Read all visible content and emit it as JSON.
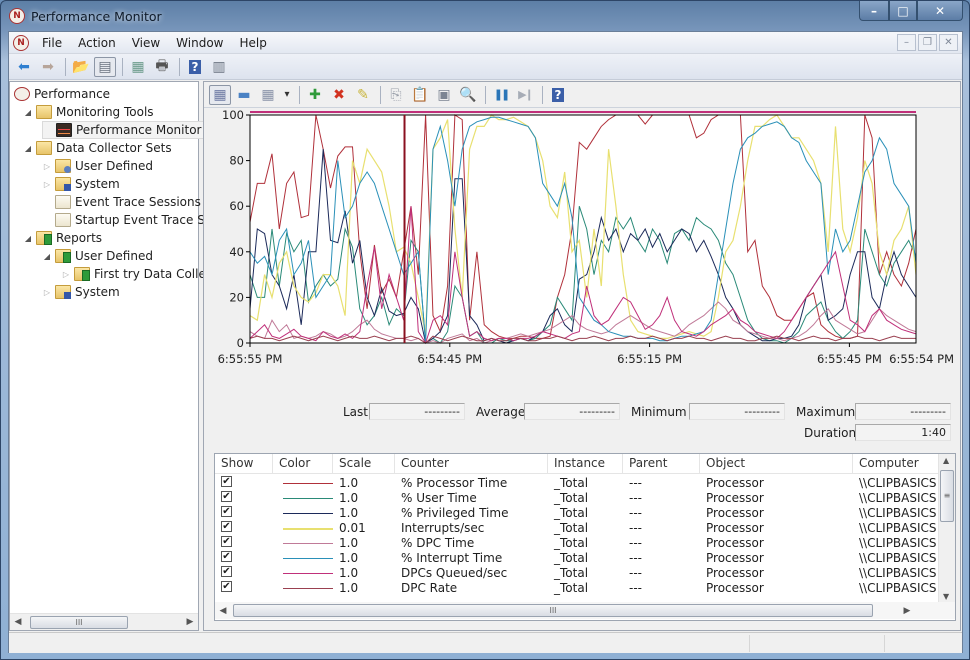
{
  "window": {
    "title": "Performance Monitor",
    "app_icon_glyph": "N",
    "caption_buttons": {
      "minimize": "–",
      "maximize": "□",
      "close": "✕"
    }
  },
  "menubar": {
    "items": [
      "File",
      "Action",
      "View",
      "Window",
      "Help"
    ],
    "mdi_buttons": {
      "minimize": "–",
      "restore": "❐",
      "close": "✕"
    }
  },
  "toolbar": {
    "items": [
      {
        "name": "back-button",
        "glyph": "⬅",
        "color": "#2f7fd0"
      },
      {
        "name": "forward-button",
        "glyph": "➡",
        "color": "#b7a59a"
      },
      {
        "name": "up-folder-button",
        "glyph": "📂",
        "color": "#d6a83a"
      },
      {
        "name": "show-hide-console-tree-button",
        "glyph": "▤",
        "color": "#6a7380"
      },
      {
        "name": "export-list-button",
        "glyph": "▦",
        "color": "#6a9a8a"
      },
      {
        "name": "print-button",
        "glyph": "🖶",
        "color": "#555"
      },
      {
        "name": "help-button",
        "glyph": "?",
        "color": "#3b5fa8"
      },
      {
        "name": "show-hide-action-pane-button",
        "glyph": "▥",
        "color": "#6a7380"
      }
    ]
  },
  "tree": {
    "items": [
      {
        "label": "Performance",
        "level": 0,
        "arrow": "",
        "icon": "root"
      },
      {
        "label": "Monitoring Tools",
        "level": 1,
        "arrow": "◢",
        "icon": "folder"
      },
      {
        "label": "Performance Monitor",
        "level": 2,
        "arrow": "",
        "icon": "perfmon",
        "selected": true
      },
      {
        "label": "Data Collector Sets",
        "level": 1,
        "arrow": "◢",
        "icon": "folder"
      },
      {
        "label": "User Defined",
        "level": 2,
        "arrow": "▷",
        "icon": "user"
      },
      {
        "label": "System",
        "level": 2,
        "arrow": "▷",
        "icon": "sys"
      },
      {
        "label": "Event Trace Sessions",
        "level": 2,
        "arrow": "",
        "icon": "doc"
      },
      {
        "label": "Startup Event Trace Ses",
        "level": 2,
        "arrow": "",
        "icon": "doc"
      },
      {
        "label": "Reports",
        "level": 1,
        "arrow": "◢",
        "icon": "report"
      },
      {
        "label": "User Defined",
        "level": 2,
        "arrow": "◢",
        "icon": "report"
      },
      {
        "label": "First try  Data Collec",
        "level": 3,
        "arrow": "▷",
        "icon": "report"
      },
      {
        "label": "System",
        "level": 2,
        "arrow": "▷",
        "icon": "sys"
      }
    ],
    "scroll_thumb_glyph": "III"
  },
  "perf_toolbar": {
    "items": [
      {
        "name": "view-current-activity-button",
        "glyph": "▦",
        "color": "#6d7aa3",
        "pressed": true
      },
      {
        "name": "view-log-data-button",
        "glyph": "▬",
        "color": "#4a82c4"
      },
      {
        "name": "change-graph-type-button",
        "glyph": "▦",
        "color": "#8a93a8"
      },
      {
        "name": "graph-type-dropdown-button",
        "glyph": "▾",
        "color": "#333"
      },
      {
        "name": "sep"
      },
      {
        "name": "add-counter-button",
        "glyph": "✚",
        "color": "#2f9a3a"
      },
      {
        "name": "delete-counter-button",
        "glyph": "✖",
        "color": "#d2321f"
      },
      {
        "name": "highlight-button",
        "glyph": "✎",
        "color": "#c8b43a"
      },
      {
        "name": "sep"
      },
      {
        "name": "copy-properties-button",
        "glyph": "⎘",
        "color": "#9aa0aa"
      },
      {
        "name": "paste-counter-list-button",
        "glyph": "📋",
        "color": "#8a8f98"
      },
      {
        "name": "properties-button",
        "glyph": "▣",
        "color": "#7d8593"
      },
      {
        "name": "zoom-button",
        "glyph": "🔍",
        "color": "#9aa0aa"
      },
      {
        "name": "sep"
      },
      {
        "name": "freeze-display-button",
        "glyph": "❚❚",
        "color": "#2a76b8"
      },
      {
        "name": "update-data-button",
        "glyph": "▶❙",
        "color": "#a6acb6"
      },
      {
        "name": "sep"
      },
      {
        "name": "perf-help-button",
        "glyph": "?",
        "color": "#3b5fa8"
      }
    ]
  },
  "stats": {
    "last_label": "Last",
    "last_value": "---------",
    "average_label": "Average",
    "average_value": "---------",
    "minimum_label": "Minimum",
    "minimum_value": "---------",
    "maximum_label": "Maximum",
    "maximum_value": "---------",
    "duration_label": "Duration",
    "duration_value": "1:40"
  },
  "legend": {
    "columns": [
      "Show",
      "Color",
      "Scale",
      "Counter",
      "Instance",
      "Parent",
      "Object",
      "Computer"
    ],
    "rows": [
      {
        "show": true,
        "color": "#b0303a",
        "scale": "1.0",
        "counter": "% Processor Time",
        "instance": "_Total",
        "parent": "---",
        "object": "Processor",
        "computer": "\\\\CLIPBASICS"
      },
      {
        "show": true,
        "color": "#2a8a78",
        "scale": "1.0",
        "counter": "% User Time",
        "instance": "_Total",
        "parent": "---",
        "object": "Processor",
        "computer": "\\\\CLIPBASICS"
      },
      {
        "show": true,
        "color": "#1c2a5a",
        "scale": "1.0",
        "counter": "% Privileged Time",
        "instance": "_Total",
        "parent": "---",
        "object": "Processor",
        "computer": "\\\\CLIPBASICS"
      },
      {
        "show": true,
        "color": "#e8e070",
        "scale": "0.01",
        "counter": "Interrupts/sec",
        "instance": "_Total",
        "parent": "---",
        "object": "Processor",
        "computer": "\\\\CLIPBASICS"
      },
      {
        "show": true,
        "color": "#c07a98",
        "scale": "1.0",
        "counter": "% DPC Time",
        "instance": "_Total",
        "parent": "---",
        "object": "Processor",
        "computer": "\\\\CLIPBASICS"
      },
      {
        "show": true,
        "color": "#2a90b8",
        "scale": "1.0",
        "counter": "% Interrupt Time",
        "instance": "_Total",
        "parent": "---",
        "object": "Processor",
        "computer": "\\\\CLIPBASICS"
      },
      {
        "show": true,
        "color": "#c0307a",
        "scale": "1.0",
        "counter": "DPCs Queued/sec",
        "instance": "_Total",
        "parent": "---",
        "object": "Processor",
        "computer": "\\\\CLIPBASICS"
      },
      {
        "show": true,
        "color": "#9a4050",
        "scale": "1.0",
        "counter": "DPC Rate",
        "instance": "_Total",
        "parent": "---",
        "object": "Processor",
        "computer": "\\\\CLIPBASICS"
      }
    ],
    "check_glyph": "✔",
    "scroll_thumb_glyph": "III"
  },
  "chart_data": {
    "type": "line",
    "title": "",
    "xlabel": "",
    "ylabel": "",
    "ylim": [
      0,
      100
    ],
    "yticks": [
      0,
      20,
      40,
      60,
      80,
      100
    ],
    "xtick_labels": [
      "6:55:55 PM",
      "6:54:45 PM",
      "6:55:15 PM",
      "6:55:45 PM",
      "6:55:54 PM"
    ],
    "xtick_positions": [
      0,
      0.3,
      0.6,
      0.9,
      1.0
    ],
    "current_time_position": 0.232,
    "grid": false,
    "legend": "table-below",
    "series": [
      {
        "name": "% Processor Time",
        "color": "#b0303a",
        "values": [
          53,
          70,
          70,
          83,
          50,
          70,
          75,
          55,
          56,
          100,
          85,
          68,
          82,
          86,
          86,
          40,
          15,
          43,
          22,
          28,
          20,
          40,
          60,
          30,
          100,
          12,
          5,
          25,
          100,
          98,
          10,
          40,
          8,
          5,
          3,
          2,
          2,
          3,
          3,
          2,
          2,
          3,
          20,
          30,
          50,
          88,
          85,
          90,
          95,
          98,
          100,
          100,
          100,
          100,
          96,
          100,
          100,
          100,
          100,
          100,
          100,
          90,
          92,
          98,
          100,
          100,
          100,
          100,
          40,
          45,
          25,
          20,
          12,
          10,
          10,
          15,
          20,
          22,
          8,
          5,
          3,
          2,
          2,
          3,
          100,
          90,
          30,
          40,
          30,
          25,
          35,
          50
        ]
      },
      {
        "name": "% User Time",
        "color": "#2a8a78",
        "values": [
          30,
          20,
          20,
          50,
          25,
          48,
          40,
          45,
          18,
          25,
          30,
          25,
          28,
          50,
          42,
          15,
          8,
          12,
          20,
          8,
          15,
          12,
          45,
          40,
          0,
          2,
          0,
          5,
          25,
          20,
          3,
          5,
          0,
          0,
          2,
          1,
          1,
          2,
          1,
          2,
          5,
          8,
          20,
          15,
          10,
          60,
          50,
          30,
          45,
          40,
          55,
          50,
          55,
          45,
          40,
          50,
          45,
          35,
          48,
          50,
          45,
          55,
          52,
          50,
          45,
          35,
          30,
          20,
          10,
          5,
          2,
          1,
          1,
          0,
          2,
          5,
          12,
          15,
          18,
          10,
          5,
          2,
          5,
          10,
          50,
          40,
          30,
          25,
          35,
          40,
          45,
          38
        ]
      },
      {
        "name": "% Privileged Time",
        "color": "#1c2a5a",
        "values": [
          15,
          50,
          48,
          30,
          25,
          15,
          30,
          8,
          40,
          40,
          85,
          45,
          44,
          58,
          35,
          45,
          20,
          12,
          24,
          14,
          12,
          13,
          20,
          15,
          0,
          2,
          5,
          12,
          72,
          72,
          12,
          8,
          1,
          2,
          1,
          0,
          1,
          2,
          1,
          3,
          5,
          12,
          15,
          8,
          5,
          28,
          30,
          40,
          55,
          45,
          50,
          40,
          48,
          45,
          50,
          42,
          48,
          40,
          45,
          50,
          48,
          40,
          45,
          38,
          30,
          20,
          15,
          8,
          5,
          3,
          1,
          1,
          2,
          2,
          3,
          8,
          20,
          25,
          30,
          10,
          12,
          15,
          30,
          40,
          40,
          20,
          15,
          30,
          40,
          30,
          25,
          20
        ]
      },
      {
        "name": "Interrupts/sec",
        "color": "#e8e070",
        "values": [
          12,
          10,
          30,
          20,
          35,
          40,
          25,
          20,
          18,
          22,
          30,
          30,
          25,
          12,
          80,
          70,
          85,
          80,
          75,
          60,
          40,
          42,
          35,
          20,
          4,
          85,
          90,
          98,
          50,
          20,
          85,
          95,
          95,
          100,
          98,
          98,
          99,
          97,
          95,
          90,
          80,
          60,
          55,
          75,
          40,
          45,
          20,
          50,
          25,
          85,
          60,
          30,
          10,
          5,
          4,
          3,
          2,
          2,
          3,
          4,
          5,
          4,
          3,
          5,
          20,
          40,
          45,
          60,
          80,
          95,
          95,
          98,
          100,
          95,
          90,
          90,
          85,
          80,
          70,
          40,
          95,
          50,
          40,
          55,
          80,
          70,
          40,
          30,
          45,
          50,
          60,
          30
        ]
      },
      {
        "name": "% DPC Time",
        "color": "#c07a98",
        "values": [
          5,
          3,
          2,
          10,
          5,
          8,
          2,
          3,
          2,
          3,
          5,
          4,
          2,
          3,
          5,
          8,
          10,
          6,
          4,
          3,
          2,
          2,
          1,
          2,
          0,
          1,
          0,
          2,
          3,
          4,
          1,
          2,
          0,
          1,
          2,
          2,
          3,
          4,
          3,
          4,
          5,
          6,
          8,
          10,
          12,
          8,
          6,
          5,
          4,
          5,
          8,
          10,
          12,
          10,
          8,
          6,
          5,
          4,
          3,
          5,
          8,
          10,
          12,
          15,
          18,
          15,
          10,
          8,
          5,
          4,
          3,
          2,
          2,
          1,
          2,
          3,
          5,
          8,
          12,
          15,
          10,
          8,
          6,
          4,
          5,
          10,
          15,
          12,
          10,
          8,
          6,
          5
        ]
      },
      {
        "name": "% Interrupt Time",
        "color": "#2a90b8",
        "values": [
          40,
          35,
          38,
          30,
          45,
          50,
          30,
          35,
          45,
          20,
          25,
          30,
          80,
          55,
          60,
          70,
          75,
          70,
          60,
          50,
          40,
          30,
          35,
          40,
          0,
          85,
          95,
          80,
          60,
          85,
          95,
          97,
          98,
          99,
          99,
          98,
          97,
          96,
          95,
          90,
          70,
          65,
          60,
          70,
          55,
          20,
          15,
          10,
          8,
          5,
          4,
          3,
          3,
          2,
          2,
          2,
          1,
          1,
          2,
          3,
          3,
          4,
          5,
          10,
          30,
          50,
          70,
          85,
          90,
          92,
          95,
          96,
          97,
          95,
          90,
          88,
          80,
          75,
          70,
          30,
          50,
          40,
          45,
          60,
          75,
          80,
          90,
          85,
          70,
          65,
          60,
          35
        ]
      },
      {
        "name": "DPCs Queued/sec",
        "color": "#c0307a",
        "values": [
          2,
          5,
          8,
          3,
          2,
          4,
          6,
          3,
          2,
          1,
          5,
          3,
          2,
          4,
          2,
          5,
          25,
          42,
          15,
          30,
          20,
          10,
          60,
          5,
          0,
          10,
          12,
          8,
          40,
          20,
          3,
          5,
          2,
          1,
          2,
          2,
          1,
          2,
          2,
          3,
          5,
          4,
          3,
          2,
          4,
          5,
          25,
          12,
          8,
          10,
          15,
          20,
          18,
          12,
          6,
          8,
          12,
          20,
          10,
          5,
          4,
          3,
          5,
          8,
          10,
          12,
          15,
          10,
          8,
          5,
          4,
          3,
          2,
          5,
          10,
          15,
          20,
          25,
          30,
          35,
          40,
          25,
          10,
          8,
          5,
          12,
          15,
          10,
          8,
          6,
          5,
          4
        ]
      },
      {
        "name": "DPC Rate",
        "color": "#9a4050",
        "values": [
          2,
          3,
          2,
          2,
          1,
          2,
          3,
          2,
          1,
          2,
          3,
          2,
          1,
          2,
          3,
          2,
          2,
          3,
          2,
          1,
          2,
          2,
          3,
          2,
          0,
          3,
          2,
          1,
          2,
          3,
          2,
          1,
          1,
          2,
          1,
          1,
          2,
          2,
          1,
          1,
          2,
          2,
          3,
          2,
          1,
          2,
          2,
          3,
          2,
          1,
          2,
          2,
          3,
          2,
          2,
          3,
          2,
          1,
          2,
          2,
          3,
          2,
          2,
          1,
          2,
          3,
          2,
          2,
          1,
          1,
          2,
          2,
          3,
          2,
          2,
          1,
          2,
          3,
          2,
          2,
          1,
          2,
          2,
          3,
          2,
          2,
          1,
          2,
          3,
          2,
          2,
          2
        ]
      }
    ]
  }
}
